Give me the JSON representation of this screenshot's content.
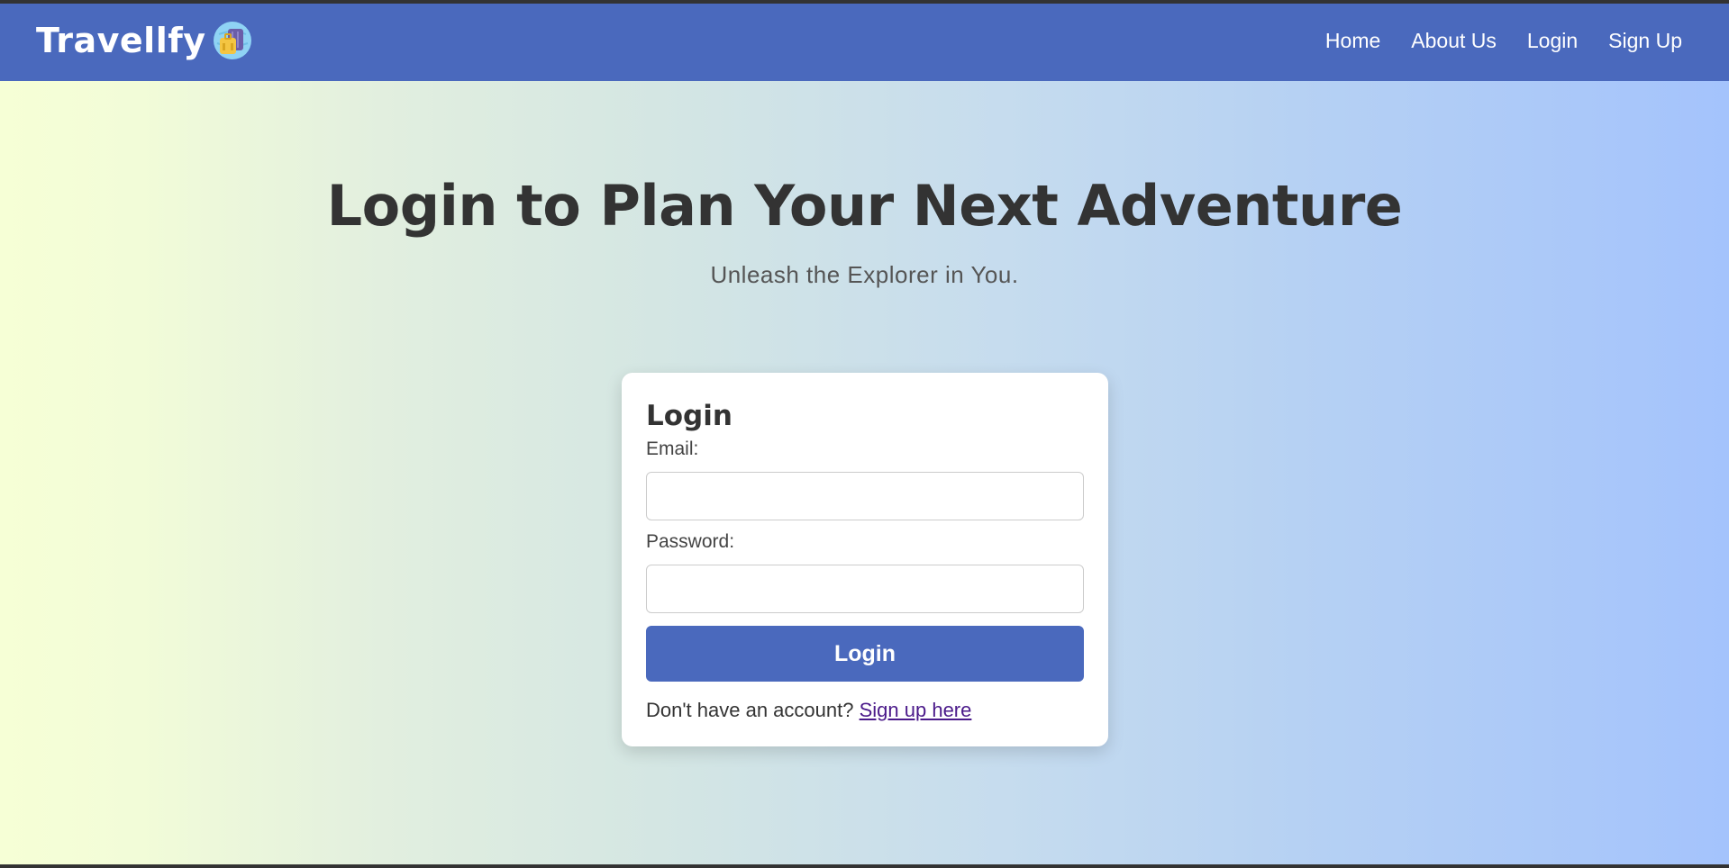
{
  "navbar": {
    "brand": "Travellfy",
    "brand_icon": "suitcase-globe-icon",
    "background": "#4a69bd",
    "links": [
      {
        "label": "Home"
      },
      {
        "label": "About Us"
      },
      {
        "label": "Login"
      },
      {
        "label": "Sign Up"
      }
    ]
  },
  "hero": {
    "title": "Login to Plan Your Next Adventure",
    "subtitle": "Unleash the Explorer in You."
  },
  "login_form": {
    "title": "Login",
    "email_label": "Email:",
    "email_value": "",
    "password_label": "Password:",
    "password_value": "",
    "submit_label": "Login",
    "signup_prompt": "Don't have an account?",
    "signup_link": "Sign up here"
  },
  "colors": {
    "accent": "#4a69bd",
    "link": "#4b1a8a",
    "gradient_start": "#f6ffd6",
    "gradient_end": "#a4c3fc"
  }
}
